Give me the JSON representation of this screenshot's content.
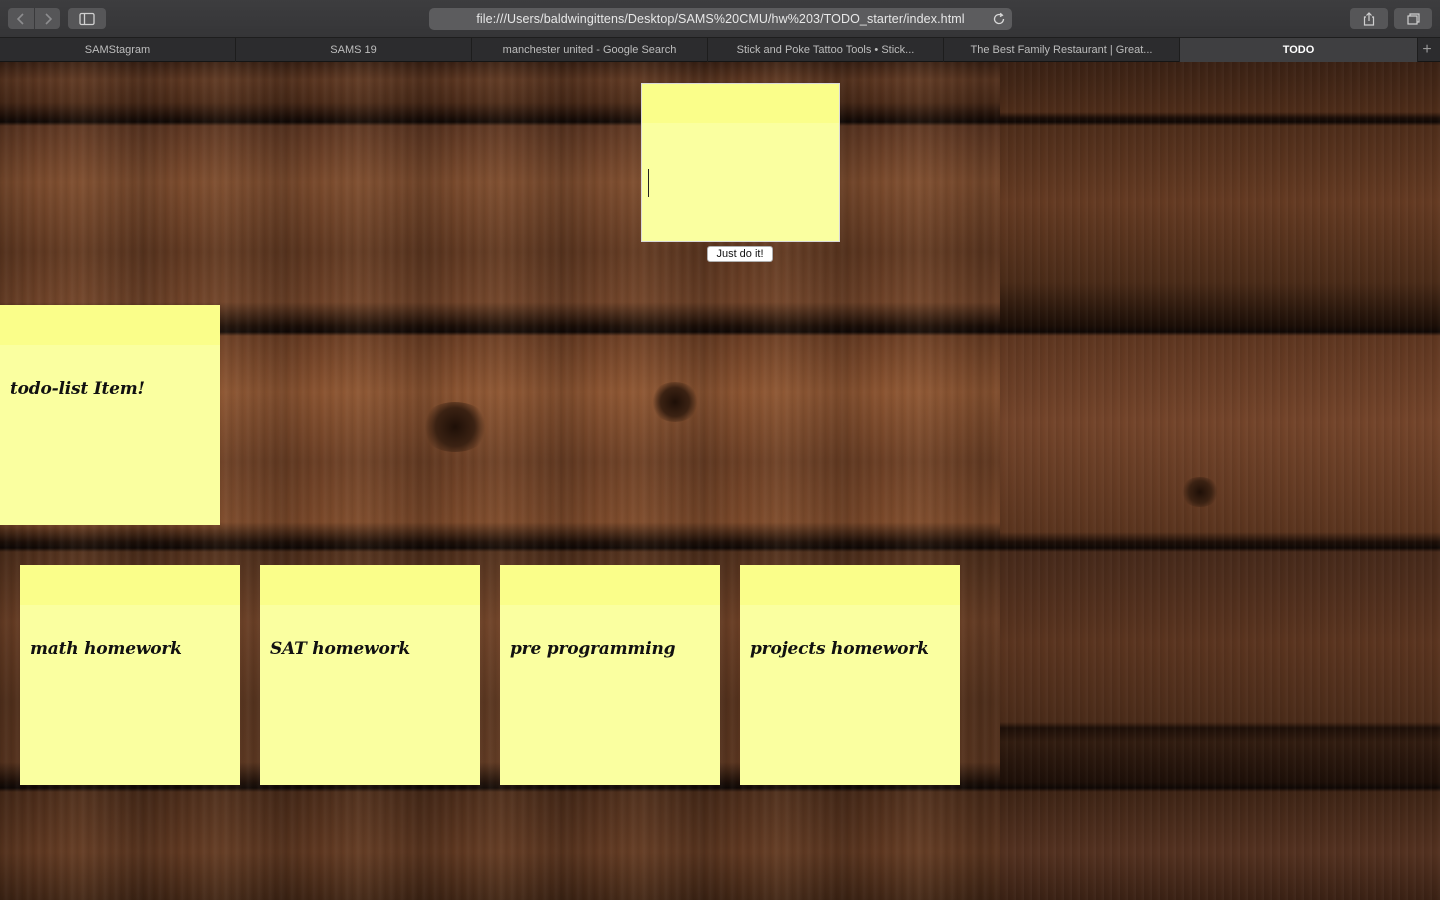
{
  "browser": {
    "url": "file:///Users/baldwingittens/Desktop/SAMS%20CMU/hw%203/TODO_starter/index.html",
    "tabs": [
      {
        "label": "SAMStagram",
        "active": false
      },
      {
        "label": "SAMS 19",
        "active": false
      },
      {
        "label": "manchester united - Google Search",
        "active": false
      },
      {
        "label": "Stick and Poke Tattoo Tools • Stick...",
        "active": false
      },
      {
        "label": "The Best Family Restaurant | Great...",
        "active": false
      },
      {
        "label": "TODO",
        "active": true
      }
    ],
    "new_tab_symbol": "+"
  },
  "page": {
    "input": {
      "value": "",
      "placeholder": ""
    },
    "submit_label": "Just do it!",
    "featured_item": "todo-list Item!",
    "items": [
      {
        "label": "math homework"
      },
      {
        "label": "SAT homework"
      },
      {
        "label": "pre programming"
      },
      {
        "label": "projects homework"
      }
    ]
  },
  "colors": {
    "note": "#faffa0",
    "note_strip": "#fafe8a",
    "wood": "#6a3e24"
  },
  "icons": [
    "chevron-left-icon",
    "chevron-right-icon",
    "sidebar-icon",
    "reload-icon",
    "share-icon",
    "tabs-overview-icon"
  ]
}
